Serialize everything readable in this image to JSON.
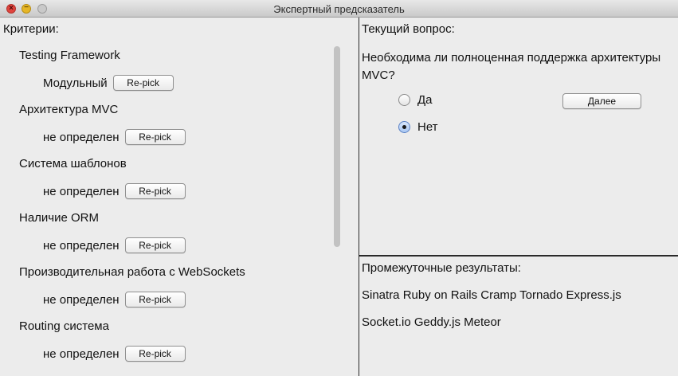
{
  "window": {
    "title": "Экспертный предсказатель"
  },
  "left": {
    "label": "Критерии:",
    "repick_label": "Re-pick",
    "criteria": [
      {
        "name": "Testing Framework",
        "value": "Модульный"
      },
      {
        "name": "Архитектура MVC",
        "value": "не определен"
      },
      {
        "name": "Система шаблонов",
        "value": "не определен"
      },
      {
        "name": "Наличие ORM",
        "value": "не определен"
      },
      {
        "name": "Производительная работа с WebSockets",
        "value": "не определен"
      },
      {
        "name": "Routing система",
        "value": "не определен"
      }
    ]
  },
  "question": {
    "label": "Текущий вопрос:",
    "text": "Необходима ли полноценная поддержка архитектуры MVC?",
    "options": [
      {
        "label": "Да",
        "selected": false
      },
      {
        "label": "Нет",
        "selected": true
      }
    ],
    "next_label": "Далее"
  },
  "results": {
    "label": "Промежуточные результаты:",
    "lines": [
      "Sinatra Ruby on Rails Cramp Tornado Express.js",
      "Socket.io Geddy.js Meteor"
    ]
  }
}
